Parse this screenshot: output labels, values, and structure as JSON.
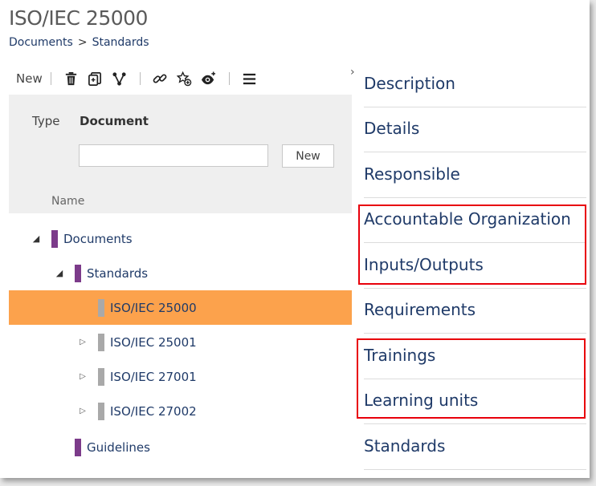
{
  "page": {
    "title": "ISO/IEC 25000",
    "breadcrumb": [
      "Documents",
      "Standards"
    ],
    "breadcrumb_separator": ">"
  },
  "toolbar": {
    "new_label": "New",
    "icons": [
      "delete-icon",
      "copy-icon",
      "hierarchy-icon",
      "link-icon",
      "favorite-add-icon",
      "watch-icon",
      "menu-icon"
    ]
  },
  "filter": {
    "type_label": "Type",
    "type_value": "Document",
    "input_value": "",
    "new_button": "New"
  },
  "tree": {
    "column_header": "Name",
    "items": [
      {
        "label": "Documents",
        "level": 0,
        "expanded": true,
        "kind": "folder"
      },
      {
        "label": "Standards",
        "level": 1,
        "expanded": true,
        "kind": "folder"
      },
      {
        "label": "ISO/IEC 25000",
        "level": 2,
        "selected": true,
        "kind": "doc"
      },
      {
        "label": "ISO/IEC 25001",
        "level": 2,
        "collapsed": true,
        "kind": "doc"
      },
      {
        "label": "ISO/IEC 27001",
        "level": 2,
        "collapsed": true,
        "kind": "doc"
      },
      {
        "label": "ISO/IEC 27002",
        "level": 2,
        "collapsed": true,
        "kind": "doc"
      },
      {
        "label": "Guidelines",
        "level": 1,
        "kind": "folder"
      }
    ]
  },
  "sections": [
    "Description",
    "Details",
    "Responsible",
    "Accountable Organization",
    "Inputs/Outputs",
    "Requirements",
    "Trainings",
    "Learning units",
    "Standards"
  ],
  "colors": {
    "selected_row": "#fca24c",
    "folder_marker": "#7c3b8a",
    "doc_marker": "#a9a9a9",
    "link_text": "#1f3a68",
    "highlight_box": "#e8000b"
  }
}
